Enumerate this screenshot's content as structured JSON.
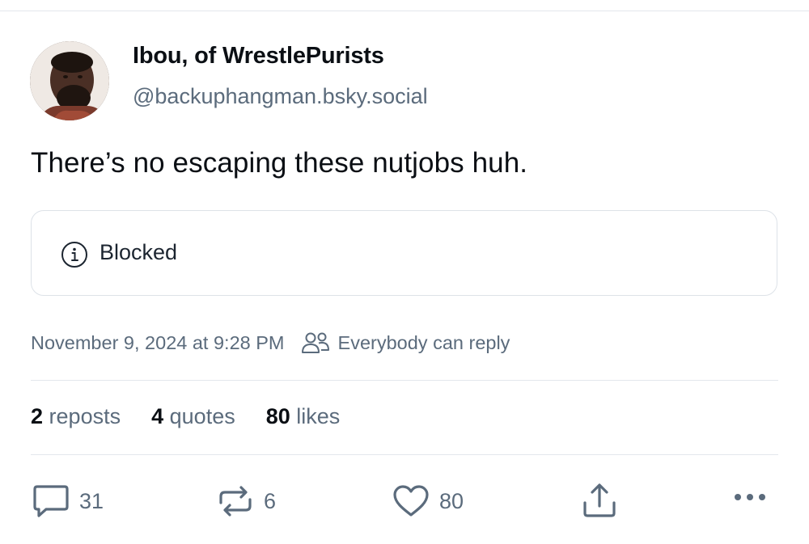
{
  "author": {
    "display_name": "Ibou, of WrestlePurists",
    "handle": "@backuphangman.bsky.social",
    "avatar_icon": "user-avatar-photo"
  },
  "post": {
    "text": "There’s no escaping these nutjobs huh.",
    "embed": {
      "icon": "info-circle-icon",
      "label": "Blocked"
    },
    "timestamp": "November 9, 2024 at 9:28 PM",
    "reply_setting": {
      "icon": "people-icon",
      "label": "Everybody can reply"
    }
  },
  "stats": {
    "reposts": {
      "count": "2",
      "label": "reposts"
    },
    "quotes": {
      "count": "4",
      "label": "quotes"
    },
    "likes": {
      "count": "80",
      "label": "likes"
    }
  },
  "actions": {
    "reply": {
      "icon": "comment-icon",
      "count": "31"
    },
    "repost": {
      "icon": "repost-icon",
      "count": "6"
    },
    "like": {
      "icon": "heart-icon",
      "count": "80"
    },
    "share": {
      "icon": "share-icon"
    },
    "more": {
      "icon": "more-horizontal-icon"
    }
  },
  "colors": {
    "text": "#0b0f14",
    "muted": "#5b6b7c",
    "border": "#dde2e8"
  }
}
